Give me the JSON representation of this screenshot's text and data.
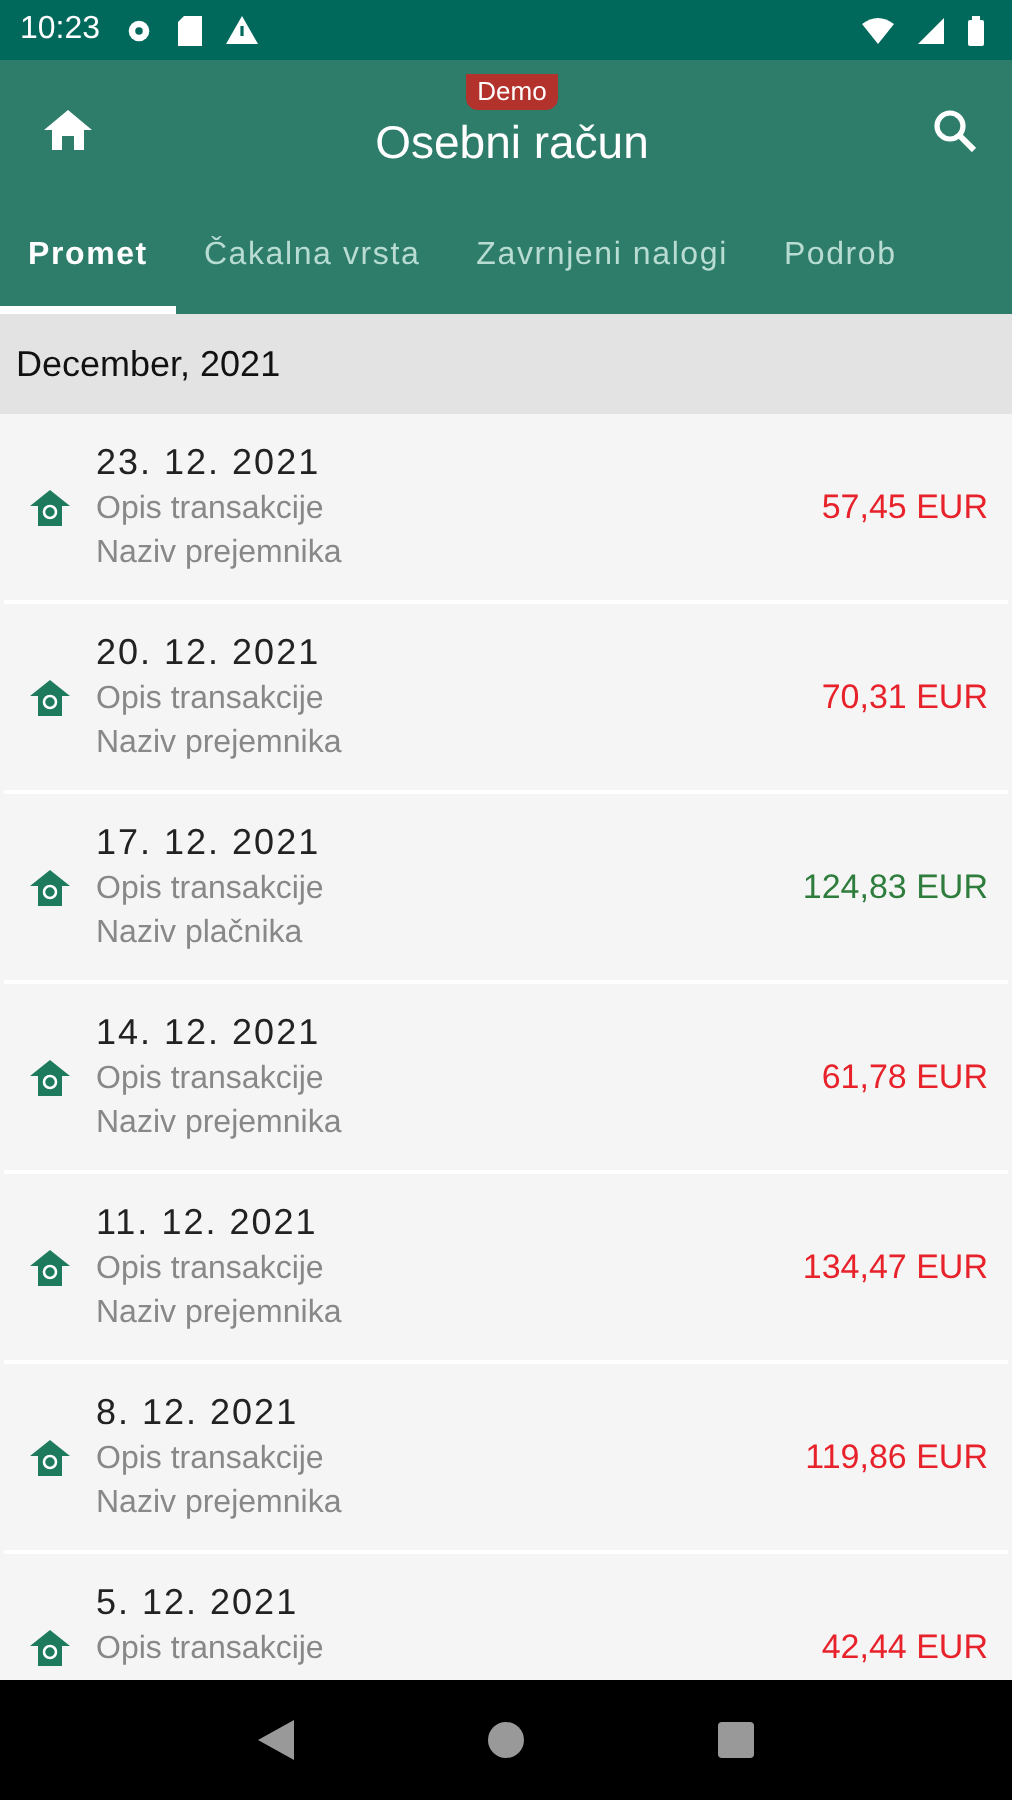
{
  "status_bar": {
    "time": "10:23"
  },
  "app_bar": {
    "title": "Osebni račun",
    "badge": "Demo"
  },
  "tabs": [
    {
      "label": "Promet",
      "selected": true
    },
    {
      "label": "Čakalna vrsta",
      "selected": false
    },
    {
      "label": "Zavrnjeni nalogi",
      "selected": false
    },
    {
      "label": "Podrob",
      "selected": false
    }
  ],
  "section": {
    "title": "December, 2021"
  },
  "transactions": [
    {
      "date": "23. 12. 2021",
      "description": "Opis transakcije",
      "party": "Naziv prejemnika",
      "amount": "57,45 EUR",
      "kind": "debit"
    },
    {
      "date": "20. 12. 2021",
      "description": "Opis transakcije",
      "party": "Naziv prejemnika",
      "amount": "70,31 EUR",
      "kind": "debit"
    },
    {
      "date": "17. 12. 2021",
      "description": "Opis transakcije",
      "party": "Naziv plačnika",
      "amount": "124,83 EUR",
      "kind": "credit"
    },
    {
      "date": "14. 12. 2021",
      "description": "Opis transakcije",
      "party": "Naziv prejemnika",
      "amount": "61,78 EUR",
      "kind": "debit"
    },
    {
      "date": "11. 12. 2021",
      "description": "Opis transakcije",
      "party": "Naziv prejemnika",
      "amount": "134,47 EUR",
      "kind": "debit"
    },
    {
      "date": "8. 12. 2021",
      "description": "Opis transakcije",
      "party": "Naziv prejemnika",
      "amount": "119,86 EUR",
      "kind": "debit"
    },
    {
      "date": "5. 12. 2021",
      "description": "Opis transakcije",
      "amount": "42,44 EUR",
      "kind": "debit"
    }
  ]
}
